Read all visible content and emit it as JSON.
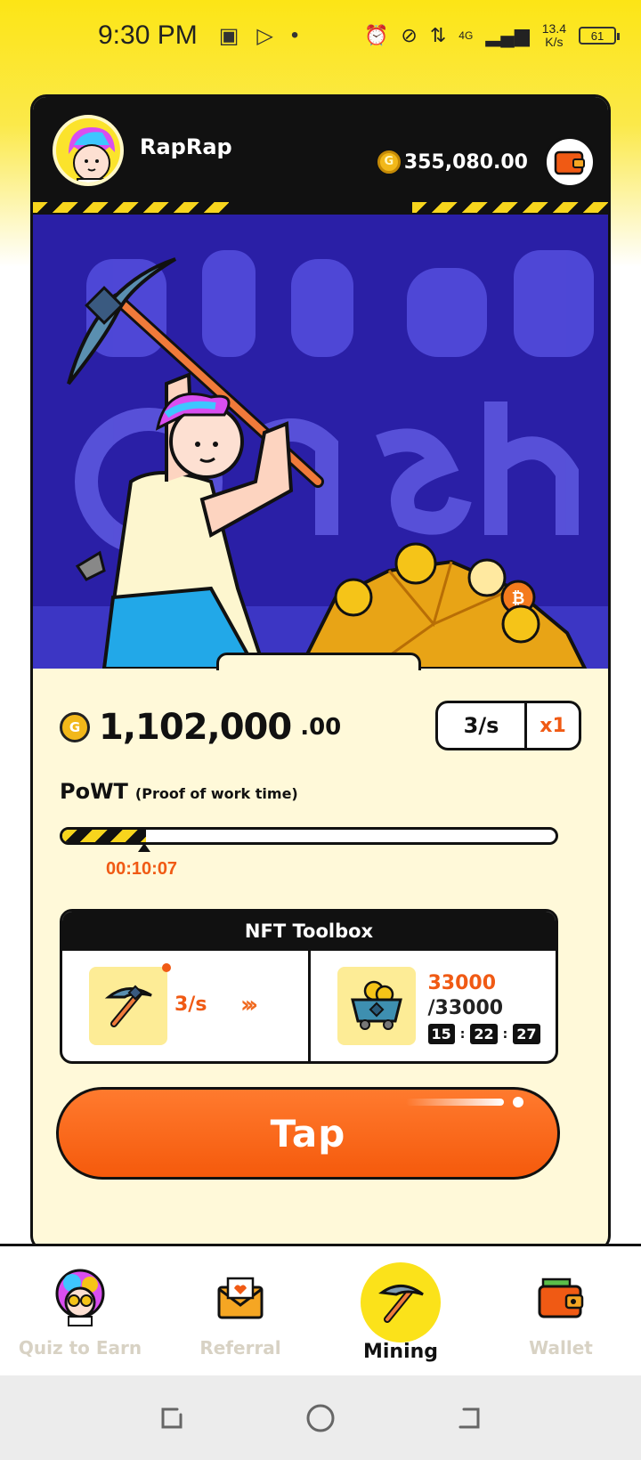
{
  "status_bar": {
    "time": "9:30 PM",
    "network": "4G",
    "speed_value": "13.4",
    "speed_unit": "K/s",
    "battery": "61"
  },
  "header": {
    "username": "RapRap",
    "balance": "355,080.00"
  },
  "mining": {
    "amount_main": "1,102,000",
    "amount_decimal": ".00",
    "rate": "3/s",
    "multiplier": "x1",
    "powt_title": "PoWT",
    "powt_subtitle": "(Proof of work time)",
    "progress_fraction": 0.17,
    "timer": "00:10:07"
  },
  "toolbox": {
    "title": "NFT Toolbox",
    "tool_rate": "3/s",
    "cart_amount": "33000",
    "cart_total": "/33000",
    "countdown": {
      "h": "15",
      "m": "22",
      "s": "27"
    }
  },
  "tap_label": "Tap",
  "nav": {
    "items": [
      {
        "label": "Quiz to Earn",
        "icon": "avatar-money-icon"
      },
      {
        "label": "Referral",
        "icon": "envelope-heart-icon"
      },
      {
        "label": "Mining",
        "icon": "pickaxe-icon"
      },
      {
        "label": "Wallet",
        "icon": "wallet-icon"
      }
    ],
    "active": "Mining"
  },
  "colors": {
    "accent": "#f05a14",
    "yellow": "#fbe21a",
    "scene_bg": "#2a1fa6"
  }
}
